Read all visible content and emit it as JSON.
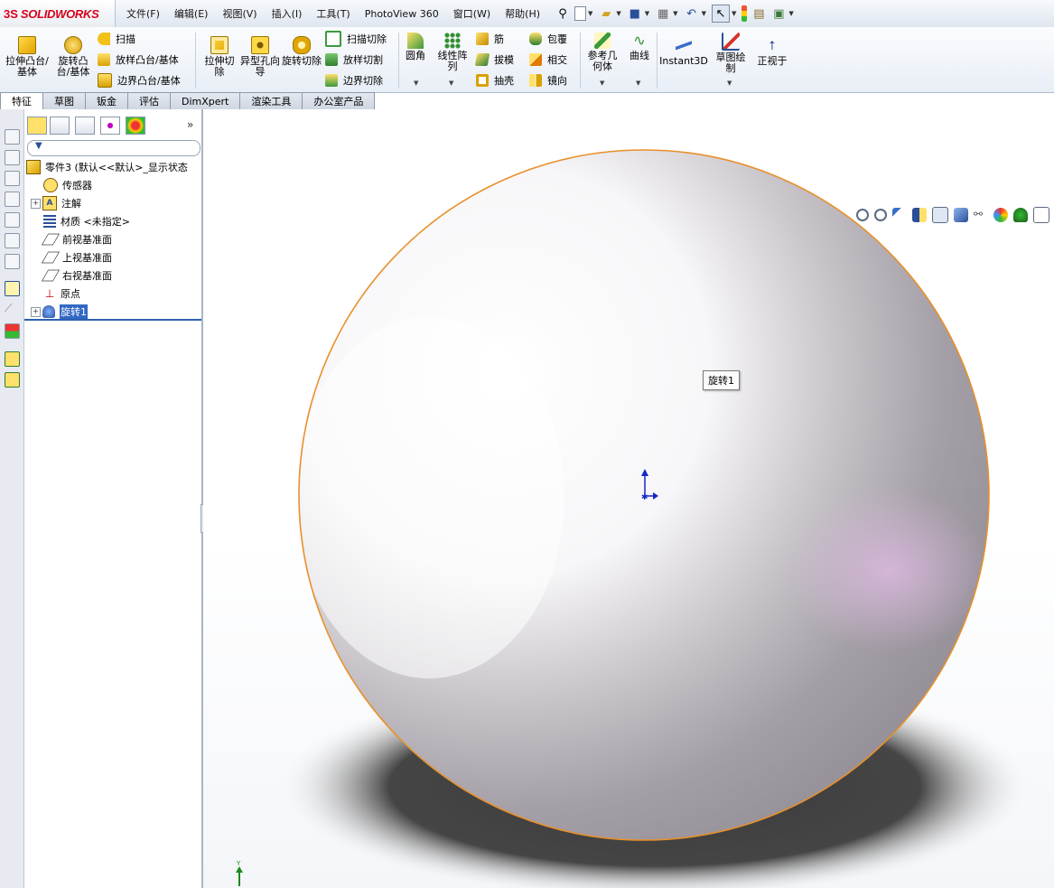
{
  "app": {
    "logo_prefix": "3S",
    "logo_text": "SOLIDWORKS"
  },
  "menu": [
    "文件(F)",
    "编辑(E)",
    "视图(V)",
    "插入(I)",
    "工具(T)",
    "PhotoView 360",
    "窗口(W)",
    "帮助(H)"
  ],
  "commands": {
    "extrude_boss": "拉伸凸台/基体",
    "revolve_boss": "旋转凸台/基体",
    "sweep": "扫描",
    "loft": "放样凸台/基体",
    "boundary": "边界凸台/基体",
    "extrude_cut": "拉伸切除",
    "hole_wizard": "异型孔向导",
    "revolve_cut": "旋转切除",
    "swept_cut": "扫描切除",
    "lofted_cut": "放样切割",
    "boundary_cut": "边界切除",
    "fillet": "圆角",
    "linear_pattern": "线性阵列",
    "rib": "筋",
    "draft": "拔模",
    "shell": "抽壳",
    "wrap": "包覆",
    "intersect": "相交",
    "mirror": "镜向",
    "ref_geometry": "参考几何体",
    "curves": "曲线",
    "instant3d": "Instant3D",
    "sketch": "草图绘制",
    "normal_to": "正视于"
  },
  "tabs": [
    "特征",
    "草图",
    "钣金",
    "评估",
    "DimXpert",
    "渲染工具",
    "办公室产品"
  ],
  "tree": {
    "root": "零件3 (默认<<默认>_显示状态",
    "items": [
      {
        "label": "传感器"
      },
      {
        "label": "注解"
      },
      {
        "label": "材质 <未指定>"
      },
      {
        "label": "前视基准面"
      },
      {
        "label": "上视基准面"
      },
      {
        "label": "右视基准面"
      },
      {
        "label": "原点"
      },
      {
        "label": "旋转1"
      }
    ]
  },
  "viewport": {
    "tooltip": "旋转1",
    "triad_axis_y": "Y"
  },
  "colors": {
    "accent": "#3168c4",
    "edge": "#e8902a",
    "brand": "#d6001c"
  }
}
